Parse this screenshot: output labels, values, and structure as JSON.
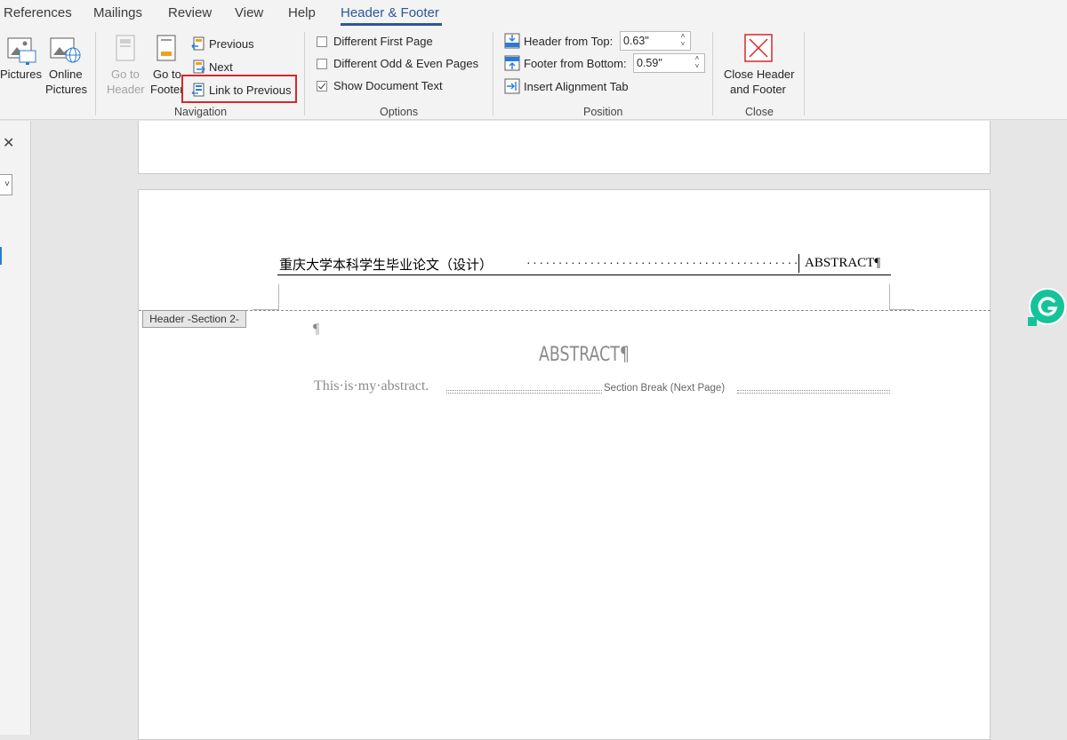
{
  "tabs": [
    {
      "label": "References",
      "active": false
    },
    {
      "label": "Mailings",
      "active": false
    },
    {
      "label": "Review",
      "active": false
    },
    {
      "label": "View",
      "active": false
    },
    {
      "label": "Help",
      "active": false
    },
    {
      "label": "Header & Footer",
      "active": true
    }
  ],
  "insert_group": {
    "pictures": "Pictures",
    "online_pictures_l1": "Online",
    "online_pictures_l2": "Pictures"
  },
  "navigation": {
    "label": "Navigation",
    "go_to_header_l1": "Go to",
    "go_to_header_l2": "Header",
    "go_to_footer_l1": "Go to",
    "go_to_footer_l2": "Footer",
    "previous": "Previous",
    "next": "Next",
    "link_to_previous": "Link to Previous"
  },
  "options": {
    "label": "Options",
    "items": [
      {
        "label": "Different First Page",
        "checked": false
      },
      {
        "label": "Different Odd & Even Pages",
        "checked": false
      },
      {
        "label": "Show Document Text",
        "checked": true
      }
    ]
  },
  "position": {
    "label": "Position",
    "header_from_top_label": "Header from Top:",
    "header_from_top_value": "0.63\"",
    "footer_from_bottom_label": "Footer from Bottom:",
    "footer_from_bottom_value": "0.59\"",
    "insert_alignment_tab": "Insert Alignment Tab"
  },
  "close": {
    "label": "Close",
    "close_btn_l1": "Close Header",
    "close_btn_l2": "and Footer"
  },
  "document": {
    "header_left_text": "重庆大学本科学生毕业论文（设计）",
    "header_right_text": "ABSTRACT¶",
    "section_tag": "Header -Section 2-",
    "para_mark": "¶",
    "heading": "ABSTRACT¶",
    "body_text": "This·is·my·abstract.",
    "section_break": "Section Break (Next Page)"
  },
  "colors": {
    "accent": "#2b579a",
    "highlight_box": "#d9262c",
    "grammarly": "#15c39a"
  }
}
